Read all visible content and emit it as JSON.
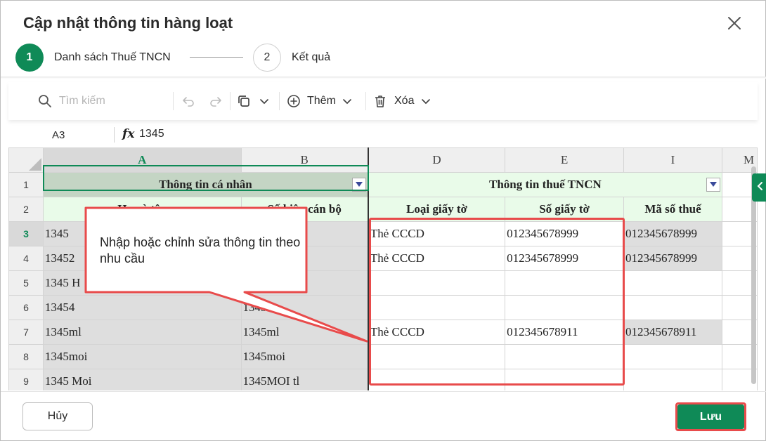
{
  "dialog": {
    "title": "Cập nhật thông tin hàng loạt",
    "steps": [
      {
        "number": "1",
        "label": "Danh sách Thuế TNCN"
      },
      {
        "number": "2",
        "label": "Kết quả"
      }
    ]
  },
  "toolbar": {
    "search_placeholder": "Tìm kiếm",
    "add_label": "Thêm",
    "delete_label": "Xóa"
  },
  "formula": {
    "cell_ref": "A3",
    "fx": "fx",
    "value": "1345"
  },
  "sheet": {
    "columns": [
      "A",
      "B",
      "D",
      "E",
      "I",
      "M"
    ],
    "group_headers": [
      "Thông tin cá nhân",
      "Thông tin thuế TNCN"
    ],
    "sub_headers": [
      "Họ và tên",
      "Số hiệu cán bộ",
      "Loại giấy tờ",
      "Số giấy tờ",
      "Mã số thuế"
    ],
    "rows": [
      {
        "num": "3",
        "a": "1345",
        "b": "",
        "d": "Thẻ CCCD",
        "e": "012345678999",
        "i": "012345678999"
      },
      {
        "num": "4",
        "a": "13452",
        "b": "",
        "d": "Thẻ CCCD",
        "e": "012345678999",
        "i": "012345678999"
      },
      {
        "num": "5",
        "a": "1345 H",
        "b": "",
        "d": "",
        "e": "",
        "i": ""
      },
      {
        "num": "6",
        "a": "13454",
        "b": "1345",
        "d": "",
        "e": "",
        "i": ""
      },
      {
        "num": "7",
        "a": "1345ml",
        "b": "1345ml",
        "d": "Thẻ CCCD",
        "e": "012345678911",
        "i": "012345678911"
      },
      {
        "num": "8",
        "a": "1345moi",
        "b": "1345moi",
        "d": "",
        "e": "",
        "i": ""
      },
      {
        "num": "9",
        "a": "1345 Moi",
        "b": "1345MOI tl",
        "d": "",
        "e": "",
        "i": ""
      }
    ]
  },
  "callout": {
    "text": "Nhập hoặc chỉnh sửa thông tin theo nhu cầu"
  },
  "footer": {
    "cancel_label": "Hủy",
    "save_label": "Lưu"
  },
  "colors": {
    "primary": "#0f8a57",
    "highlight": "#e84b4b"
  }
}
